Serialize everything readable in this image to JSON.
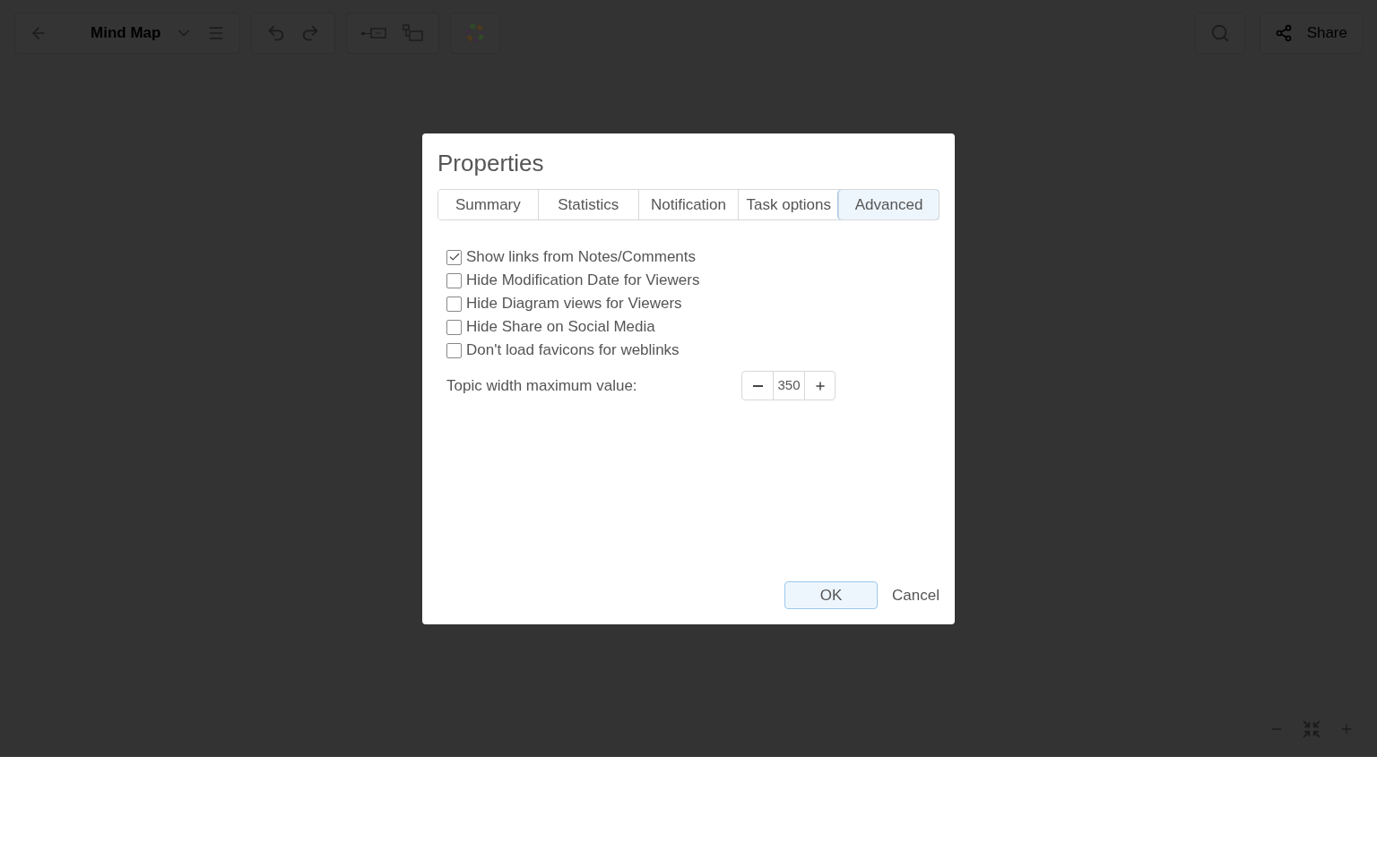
{
  "toolbar": {
    "title": "Mind Map",
    "share": "Share"
  },
  "dialog": {
    "title": "Properties",
    "tabs": [
      {
        "label": "Summary",
        "selected": false
      },
      {
        "label": "Statistics",
        "selected": false
      },
      {
        "label": "Notification",
        "selected": false
      },
      {
        "label": "Task options",
        "selected": false
      },
      {
        "label": "Advanced",
        "selected": true
      }
    ],
    "options": [
      {
        "label": "Show links from Notes/Comments",
        "checked": true
      },
      {
        "label": "Hide Modification Date for Viewers",
        "checked": false
      },
      {
        "label": "Hide Diagram views for Viewers",
        "checked": false
      },
      {
        "label": "Hide Share on Social Media",
        "checked": false
      },
      {
        "label": "Don't load favicons for weblinks",
        "checked": false
      }
    ],
    "topic_width": {
      "label": "Topic width maximum value:",
      "value": "350"
    },
    "buttons": {
      "ok": "OK",
      "cancel": "Cancel"
    }
  }
}
